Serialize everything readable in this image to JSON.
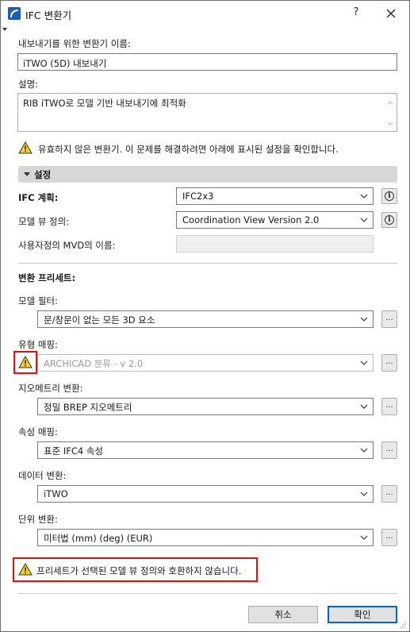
{
  "window": {
    "title": "IFC 변환기",
    "help_label": "?",
    "close_icon": "close-icon",
    "app_icon": "archicad-logo-icon"
  },
  "translator_name": {
    "label": "내보내기를 위한 변환기 이름:",
    "value": "iTWO (5D) 내보내기"
  },
  "description": {
    "label": "설명:",
    "value": "RIB iTWO로 모델 기반 내보내기에 최적화"
  },
  "top_warning": {
    "icon": "warning-icon",
    "text": "유효하지 않은 변환기. 이 문제를 해결하려면 아래에 표시된 설정을 확인합니다."
  },
  "settings_section": {
    "title": "설정",
    "expanded": true
  },
  "ifc_schema": {
    "label": "IFC 계획:",
    "value": "IFC2x3",
    "info_icon": "info-icon"
  },
  "model_view": {
    "label": "모델 뷰 정의:",
    "value": "Coordination View Version 2.0",
    "info_icon": "info-icon"
  },
  "custom_mvd": {
    "label": "사용자정의 MVD의 이름:",
    "value": ""
  },
  "presets": {
    "heading": "변환 프리세트:",
    "items": [
      {
        "label": "모델 필터:",
        "value": "문/창문이 없는 모든 3D 요소",
        "button": "..."
      },
      {
        "label": "유형 매핑:",
        "value": "ARCHICAD 분류 - v 2.0",
        "button": "...",
        "warning": true,
        "disabled": true
      },
      {
        "label": "지오메트리 변환:",
        "value": "정밀 BREP 지오메트리",
        "button": "..."
      },
      {
        "label": "속성 매핑:",
        "value": "표준 IFC4 속성",
        "button": "..."
      },
      {
        "label": "데이터 변환:",
        "value": "iTWO",
        "button": "..."
      },
      {
        "label": "단위 변환:",
        "value": "미터법 (mm) (deg) (EUR)",
        "button": "..."
      }
    ]
  },
  "bottom_warning": {
    "icon": "warning-icon",
    "text": "프리세트가 선택된 모델 뷰 정의와 호환하지 않습니다."
  },
  "footer": {
    "cancel_label": "취소",
    "ok_label": "확인"
  },
  "colors": {
    "highlight_red": "#e01010",
    "warning_yellow": "#f6d21e",
    "primary_border": "#0a63c9",
    "section_bar": "#d7d7d7"
  }
}
